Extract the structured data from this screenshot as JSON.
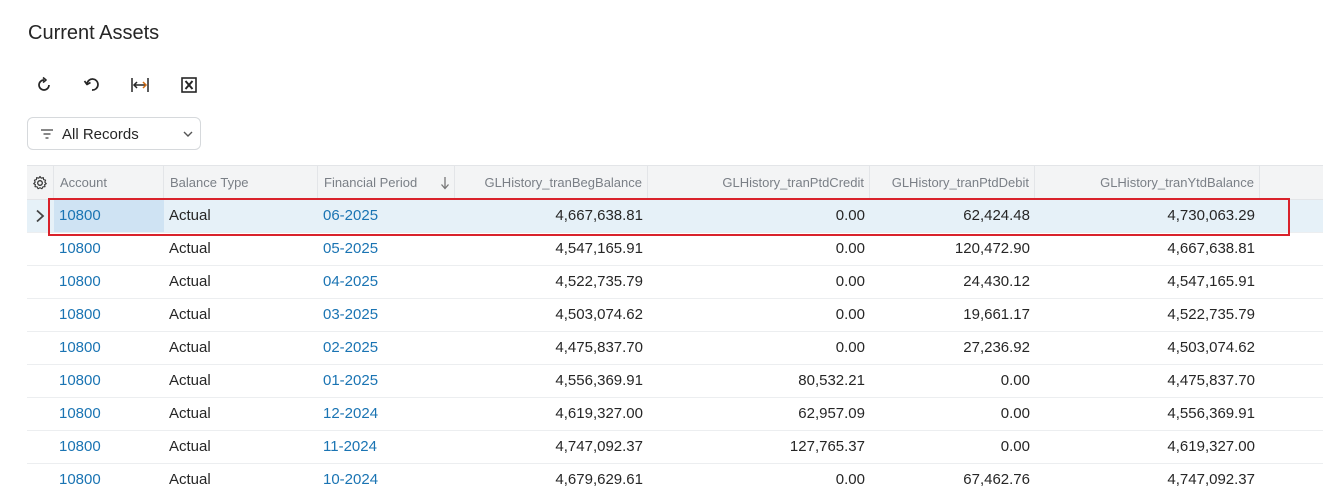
{
  "page": {
    "title": "Current Assets"
  },
  "toolbar": {
    "buttons": [
      {
        "name": "refresh-icon"
      },
      {
        "name": "undo-icon"
      },
      {
        "name": "fit-columns-icon"
      },
      {
        "name": "excel-export-icon"
      }
    ]
  },
  "filter": {
    "label": "All Records",
    "icon": "filter-icon"
  },
  "grid": {
    "settings_icon": "gear-icon",
    "columns": [
      "Account",
      "Balance Type",
      "Financial Period",
      "GLHistory_tranBegBalance",
      "GLHistory_tranPtdCredit",
      "GLHistory_tranPtdDebit",
      "GLHistory_tranYtdBalance"
    ],
    "sort_icon": "sort-down-arrow-icon",
    "rows": [
      {
        "account": "10800",
        "balance_type": "Actual",
        "period": "06-2025",
        "beg": "4,667,638.81",
        "credit": "0.00",
        "debit": "62,424.48",
        "ytd": "4,730,063.29"
      },
      {
        "account": "10800",
        "balance_type": "Actual",
        "period": "05-2025",
        "beg": "4,547,165.91",
        "credit": "0.00",
        "debit": "120,472.90",
        "ytd": "4,667,638.81"
      },
      {
        "account": "10800",
        "balance_type": "Actual",
        "period": "04-2025",
        "beg": "4,522,735.79",
        "credit": "0.00",
        "debit": "24,430.12",
        "ytd": "4,547,165.91"
      },
      {
        "account": "10800",
        "balance_type": "Actual",
        "period": "03-2025",
        "beg": "4,503,074.62",
        "credit": "0.00",
        "debit": "19,661.17",
        "ytd": "4,522,735.79"
      },
      {
        "account": "10800",
        "balance_type": "Actual",
        "period": "02-2025",
        "beg": "4,475,837.70",
        "credit": "0.00",
        "debit": "27,236.92",
        "ytd": "4,503,074.62"
      },
      {
        "account": "10800",
        "balance_type": "Actual",
        "period": "01-2025",
        "beg": "4,556,369.91",
        "credit": "80,532.21",
        "debit": "0.00",
        "ytd": "4,475,837.70"
      },
      {
        "account": "10800",
        "balance_type": "Actual",
        "period": "12-2024",
        "beg": "4,619,327.00",
        "credit": "62,957.09",
        "debit": "0.00",
        "ytd": "4,556,369.91"
      },
      {
        "account": "10800",
        "balance_type": "Actual",
        "period": "11-2024",
        "beg": "4,747,092.37",
        "credit": "127,765.37",
        "debit": "0.00",
        "ytd": "4,619,327.00"
      },
      {
        "account": "10800",
        "balance_type": "Actual",
        "period": "10-2024",
        "beg": "4,679,629.61",
        "credit": "0.00",
        "debit": "67,462.76",
        "ytd": "4,747,092.37"
      }
    ]
  },
  "colors": {
    "link": "#1a74b3",
    "selected_row": "#e6f1f8",
    "highlight_border": "#d9222b"
  }
}
